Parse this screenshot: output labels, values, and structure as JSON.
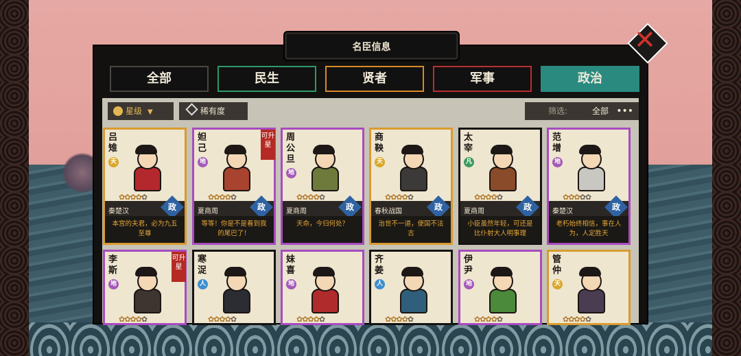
{
  "window_title": "名臣信息",
  "tabs": [
    {
      "label": "全部",
      "border": "#4a4640"
    },
    {
      "label": "民生",
      "border": "#2f9a6a"
    },
    {
      "label": "贤者",
      "border": "#d98a28"
    },
    {
      "label": "军事",
      "border": "#b83030"
    },
    {
      "label": "政治",
      "border": "#2a8a80"
    }
  ],
  "active_tab": "政治",
  "sort": {
    "label": "星级",
    "icon": "star-flower-icon"
  },
  "rarity": {
    "label": "稀有度",
    "icon": "diamond-icon"
  },
  "filter": {
    "label": "筛选:",
    "value": "全部",
    "more": "•••"
  },
  "colors": {
    "tab_active": "#2a8a80",
    "quote_text": "#e6a636",
    "card_gold": "#d99b2f",
    "card_purple": "#a84bc0",
    "upgrade_red": "#b52a24",
    "stat_blue": "#2f62a2"
  },
  "cards": [
    {
      "name": "吕\n雉",
      "grade": "天",
      "rarity": "gold",
      "stars": "✿✿✿✿",
      "stars_empty": "✿",
      "era": "秦楚汉",
      "stat": "政",
      "quote": "本宫的夫君，必为九五至尊",
      "upgrade": "",
      "robe": "#b3282d"
    },
    {
      "name": "妲\n己",
      "grade": "地",
      "rarity": "purple",
      "stars": "✿✿✿✿",
      "stars_empty": "✿",
      "era": "夏商周",
      "stat": "政",
      "quote": "等等！你是不是看到我的尾巴了！",
      "upgrade": "可升星",
      "robe": "#a7432e"
    },
    {
      "name": "周\n公\n旦",
      "grade": "地",
      "rarity": "purple",
      "stars": "✿✿✿✿",
      "stars_empty": "✿",
      "era": "夏商周",
      "stat": "政",
      "quote": "天命，今归何处？",
      "upgrade": "",
      "robe": "#6d7a3c"
    },
    {
      "name": "商\n鞅",
      "grade": "天",
      "rarity": "gold",
      "stars": "✿✿✿✿",
      "stars_empty": "✿",
      "era": "春秋战国",
      "stat": "政",
      "quote": "治世不一道，便国不法古",
      "upgrade": "",
      "robe": "#3c3a38"
    },
    {
      "name": "太\n宰",
      "grade": "凡",
      "rarity": "black",
      "stars": "✿✿✿✿",
      "stars_empty": "✿",
      "era": "夏商周",
      "stat": "政",
      "quote": "小臣虽然年轻，可还是比仆射大人明事理",
      "upgrade": "",
      "robe": "#8a4b2a"
    },
    {
      "name": "范\n增",
      "grade": "地",
      "rarity": "purple",
      "stars": "✿✿✿",
      "stars_empty": "✿✿",
      "era": "秦楚汉",
      "stat": "政",
      "quote": "老朽始终相信，事在人为，人定胜天",
      "upgrade": "",
      "robe": "#c9c7c2"
    },
    {
      "name": "李\n斯",
      "grade": "地",
      "rarity": "purple",
      "stars": "✿✿✿✿",
      "stars_empty": "✿",
      "era": "",
      "stat": "",
      "quote": "",
      "upgrade": "可升星",
      "robe": "#3f3530"
    },
    {
      "name": "寒\n浞",
      "grade": "人",
      "rarity": "black",
      "stars": "✿✿✿✿",
      "stars_empty": "✿",
      "era": "",
      "stat": "",
      "quote": "",
      "upgrade": "",
      "robe": "#2b2d33"
    },
    {
      "name": "妹\n喜",
      "grade": "地",
      "rarity": "purple",
      "stars": "✿✿✿✿",
      "stars_empty": "✿",
      "era": "",
      "stat": "",
      "quote": "",
      "upgrade": "",
      "robe": "#b02b2b"
    },
    {
      "name": "齐\n姜",
      "grade": "人",
      "rarity": "black",
      "stars": "✿✿✿✿",
      "stars_empty": "✿",
      "era": "",
      "stat": "",
      "quote": "",
      "upgrade": "",
      "robe": "#2f5f7a"
    },
    {
      "name": "伊\n尹",
      "grade": "地",
      "rarity": "purple",
      "stars": "✿✿✿✿",
      "stars_empty": "✿",
      "era": "",
      "stat": "",
      "quote": "",
      "upgrade": "",
      "robe": "#4b8a3a"
    },
    {
      "name": "管\n仲",
      "grade": "天",
      "rarity": "gold",
      "stars": "✿✿✿✿",
      "stars_empty": "✿",
      "era": "",
      "stat": "",
      "quote": "",
      "upgrade": "",
      "robe": "#4a3d52"
    }
  ]
}
